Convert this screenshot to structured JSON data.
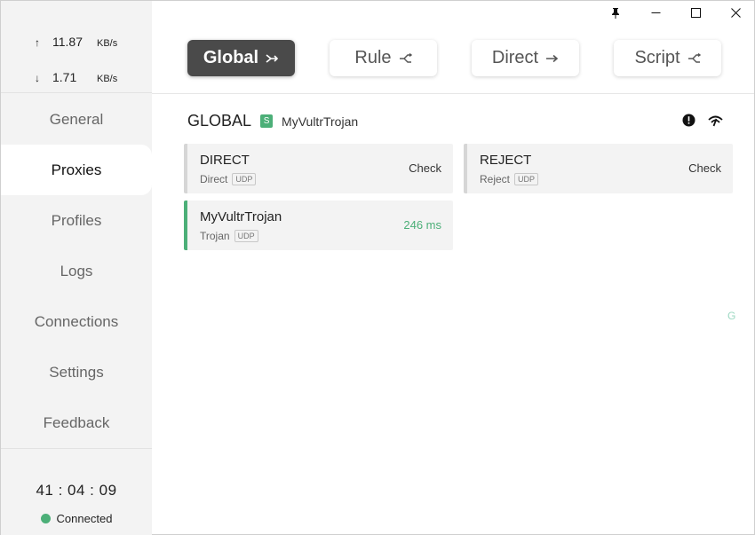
{
  "window": {
    "controls": [
      {
        "name": "pin-icon"
      },
      {
        "name": "minimize-icon"
      },
      {
        "name": "maximize-icon"
      },
      {
        "name": "close-icon"
      }
    ]
  },
  "traffic": {
    "up": {
      "arrow": "↑",
      "value": "11.87",
      "unit": "KB/s"
    },
    "down": {
      "arrow": "↓",
      "value": "1.71",
      "unit": "KB/s"
    }
  },
  "nav": {
    "items": [
      {
        "label": "General"
      },
      {
        "label": "Proxies"
      },
      {
        "label": "Profiles"
      },
      {
        "label": "Logs"
      },
      {
        "label": "Connections"
      },
      {
        "label": "Settings"
      },
      {
        "label": "Feedback"
      }
    ],
    "active": "Proxies"
  },
  "footer": {
    "uptime": "41 : 04 : 09",
    "status": "Connected",
    "status_color": "#4caf78"
  },
  "modes": {
    "items": [
      {
        "label": "Global",
        "icon": "merge-arrows-icon"
      },
      {
        "label": "Rule",
        "icon": "split-icon"
      },
      {
        "label": "Direct",
        "icon": "arrow-right-icon"
      },
      {
        "label": "Script",
        "icon": "split-icon"
      }
    ],
    "active": "Global"
  },
  "group": {
    "name": "GLOBAL",
    "badge": "S",
    "selected": "MyVultrTrojan",
    "icons": [
      "alert-icon",
      "speed-test-icon"
    ]
  },
  "proxies": [
    {
      "name": "DIRECT",
      "type": "Direct",
      "udp": "UDP",
      "right": "Check",
      "selected": false
    },
    {
      "name": "REJECT",
      "type": "Reject",
      "udp": "UDP",
      "right": "Check",
      "selected": false
    },
    {
      "name": "MyVultrTrojan",
      "type": "Trojan",
      "udp": "UDP",
      "right": "246 ms",
      "selected": true
    }
  ],
  "corner_mark": "G",
  "colors": {
    "accent": "#4caf78",
    "active_mode": "#4a4a4a",
    "sidebar": "#f3f3f3"
  }
}
